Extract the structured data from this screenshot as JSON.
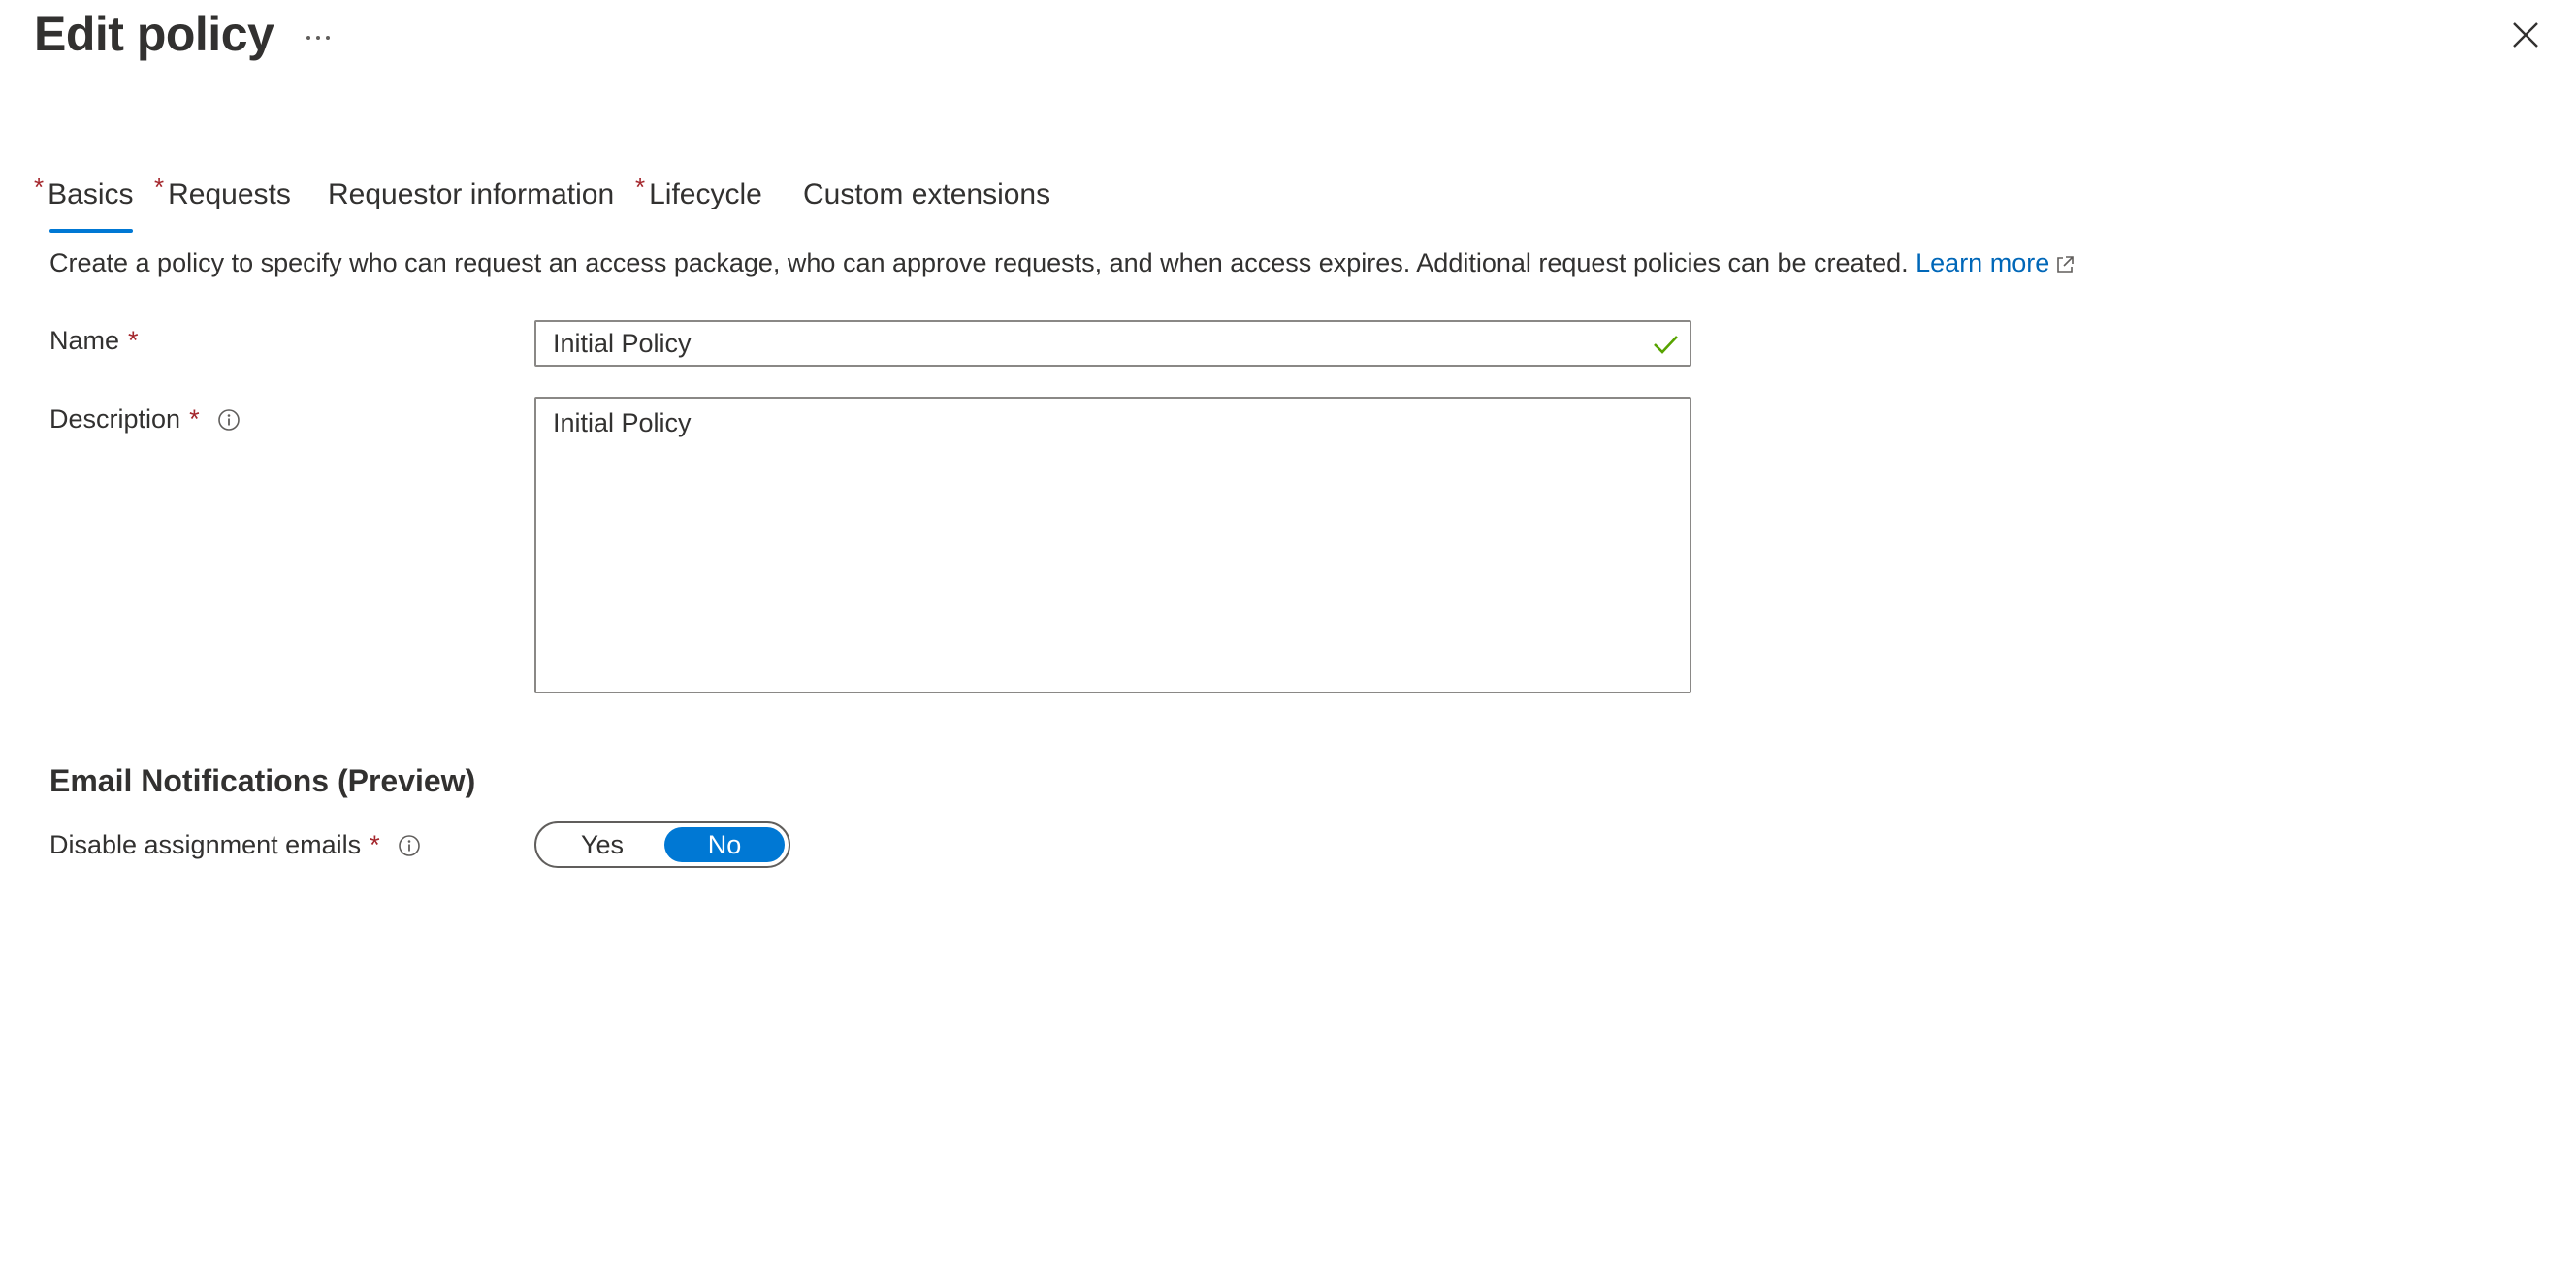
{
  "header": {
    "title": "Edit policy",
    "more_label": "···"
  },
  "tabs": [
    {
      "label": "Basics",
      "required": "*"
    },
    {
      "label": "Requests",
      "required": "*"
    },
    {
      "label": "Requestor information",
      "required": ""
    },
    {
      "label": "Lifecycle",
      "required": "*"
    },
    {
      "label": "Custom extensions",
      "required": ""
    }
  ],
  "intro": {
    "text": "Create a policy to specify who can request an access package, who can approve requests, and when access expires. Additional request policies can be created.",
    "link": "Learn more"
  },
  "form": {
    "name_label": "Name",
    "name_required": "*",
    "name_value": "Initial Policy",
    "description_label": "Description",
    "description_required": "*",
    "description_value": "Initial Policy"
  },
  "email_section": {
    "title": "Email Notifications (Preview)",
    "disable_label": "Disable assignment emails",
    "disable_required": "*",
    "options": [
      "Yes",
      "No"
    ],
    "selected": "No"
  },
  "colors": {
    "accent": "#0078d4",
    "link": "#0067b8",
    "required": "#a4262c",
    "valid_check": "#57a300",
    "text": "#323130"
  },
  "icons": [
    "more-icon",
    "close-icon",
    "external-link-icon",
    "info-icon",
    "checkmark-icon"
  ]
}
